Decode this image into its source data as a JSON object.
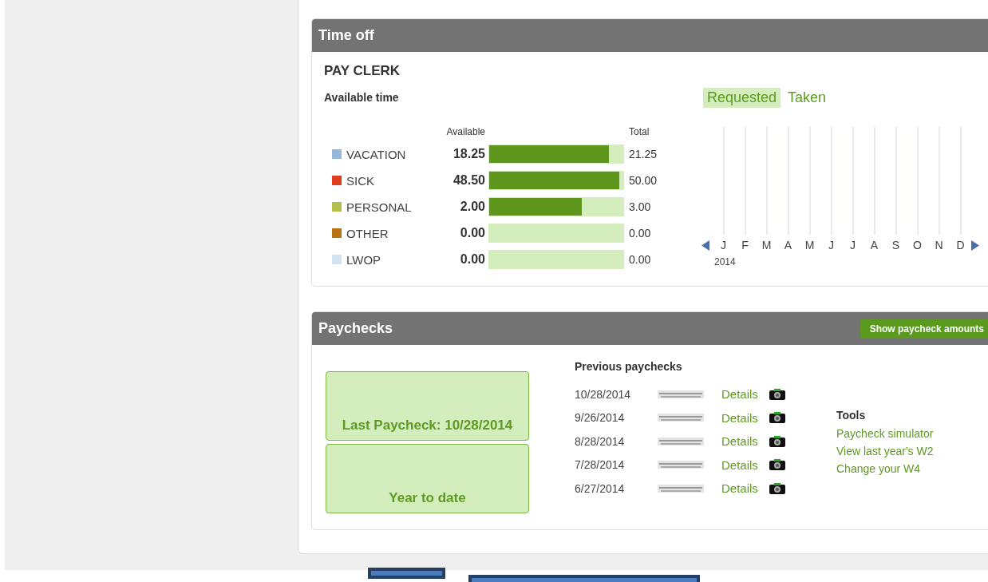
{
  "time_off": {
    "title": "Time off",
    "employee": "PAY CLERK",
    "subtitle": "Available time",
    "columns": {
      "available": "Available",
      "total": "Total"
    },
    "categories": [
      {
        "name": "VACATION",
        "color": "#93b8d9",
        "available": "18.25",
        "total": "21.25",
        "level": 0.89
      },
      {
        "name": "SICK",
        "color": "#e03c1f",
        "available": "48.50",
        "total": "50.00",
        "level": 0.97
      },
      {
        "name": "PERSONAL",
        "color": "#b3bf4a",
        "available": "2.00",
        "total": "3.00",
        "level": 0.69
      },
      {
        "name": "OTHER",
        "color": "#b87414",
        "available": "0.00",
        "total": "0.00"
      },
      {
        "name": "LWOP",
        "color": "#d3e2ef",
        "available": "0.00",
        "total": "0.00"
      }
    ],
    "tabs": [
      {
        "label": "Requested",
        "selected": true
      },
      {
        "label": "Taken",
        "selected": false
      }
    ],
    "months": [
      "J",
      "F",
      "M",
      "A",
      "M",
      "J",
      "J",
      "A",
      "S",
      "O",
      "N",
      "D"
    ],
    "year": "2014"
  },
  "paychecks": {
    "title": "Paychecks",
    "show_button": "Show paycheck amounts",
    "summary": [
      "Last Paycheck: 10/28/2014",
      "Year to date"
    ],
    "previous_title": "Previous paychecks",
    "rows": [
      {
        "date": "10/28/2014",
        "link": "Details"
      },
      {
        "date": "9/26/2014",
        "link": "Details"
      },
      {
        "date": "8/28/2014",
        "link": "Details"
      },
      {
        "date": "7/28/2014",
        "link": "Details"
      },
      {
        "date": "6/27/2014",
        "link": "Details"
      }
    ],
    "tools_title": "Tools",
    "tools": [
      "Paycheck simulator",
      "View last year's W2",
      "Change your W4"
    ]
  }
}
